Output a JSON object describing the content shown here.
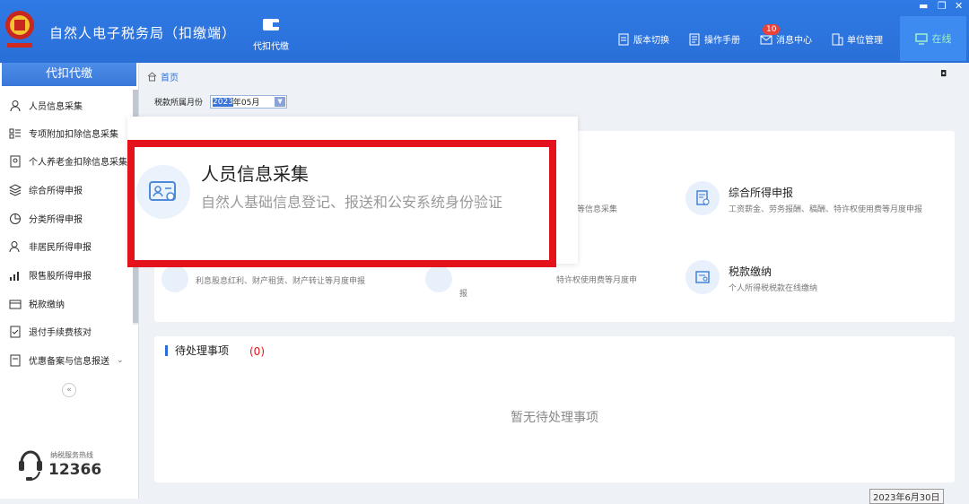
{
  "header": {
    "app_title": "自然人电子税务局（扣缴端）",
    "module_label": "代扣代缴",
    "toolbar": [
      {
        "label": "版本切换",
        "icon": "switch-icon"
      },
      {
        "label": "操作手册",
        "icon": "manual-icon"
      },
      {
        "label": "消息中心",
        "icon": "message-icon",
        "badge": "10"
      },
      {
        "label": "单位管理",
        "icon": "building-icon"
      }
    ],
    "status": "在线",
    "brand_color": "#2f7ae5"
  },
  "sidebar": {
    "title": "代扣代缴",
    "items": [
      {
        "label": "人员信息采集",
        "icon": "person-icon"
      },
      {
        "label": "专项附加扣除信息采集",
        "icon": "list-icon"
      },
      {
        "label": "个人养老金扣除信息采集",
        "icon": "pension-icon"
      },
      {
        "label": "综合所得申报",
        "icon": "layers-icon"
      },
      {
        "label": "分类所得申报",
        "icon": "pie-icon"
      },
      {
        "label": "非居民所得申报",
        "icon": "nonresident-icon"
      },
      {
        "label": "限售股所得申报",
        "icon": "bar-chart-icon"
      },
      {
        "label": "税款缴纳",
        "icon": "wallet-icon"
      },
      {
        "label": "退付手续费核对",
        "icon": "check-doc-icon"
      },
      {
        "label": "优惠备案与信息报送",
        "icon": "record-icon"
      }
    ],
    "collapse_symbol": "«",
    "hotline_label": "纳税服务热线",
    "hotline_number": "12366"
  },
  "main": {
    "breadcrumb": "首页",
    "month_label": "税款所属月份",
    "month_year": "2023",
    "month_rest": "年05月",
    "cards": [
      {
        "title": "综合所得申报",
        "desc": "工资薪金、劳务报酬、稿酬、特许权使用费等月度申报",
        "icon": "tax-doc-icon"
      },
      {
        "title": "税款缴纳",
        "desc": "个人所得税税款在线缴纳",
        "icon": "payment-icon"
      }
    ],
    "partial_desc_1": "出等信息采集",
    "partial_desc_2": "利息股息红利、财产租赁、财产转让等月度申报",
    "partial_desc_3": "特许权使用费等月度申",
    "partial_desc_3b": "报",
    "highlight": {
      "title": "人员信息采集",
      "desc": "自然人基础信息登记、报送和公安系统身份验证",
      "border_color": "#e4131b"
    },
    "todo": {
      "title": "待处理事项",
      "count": "(0)",
      "empty": "暂无待处理事项"
    },
    "date_tag": "2023年6月30日"
  }
}
